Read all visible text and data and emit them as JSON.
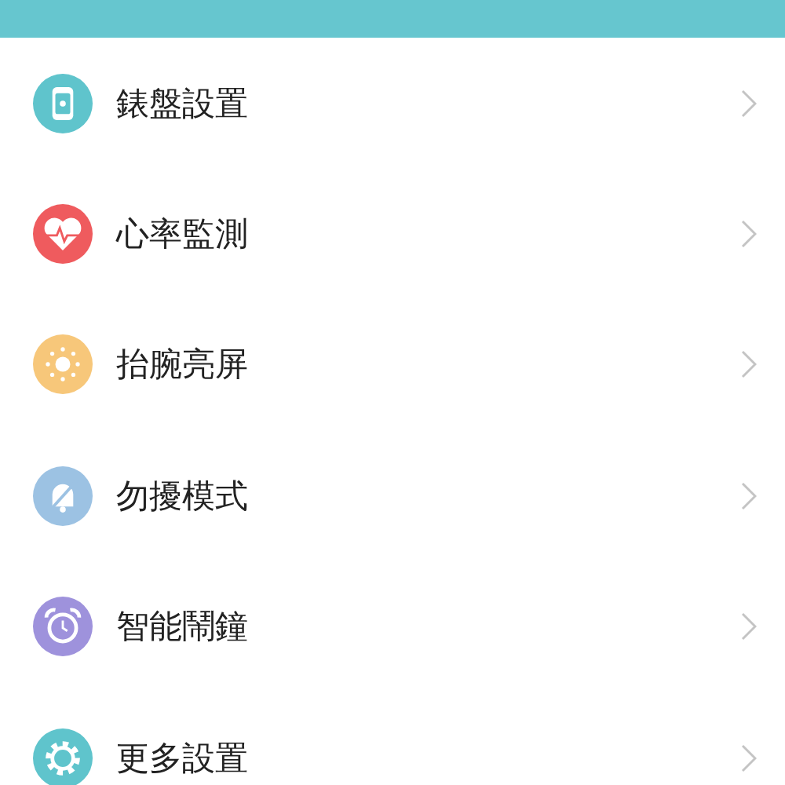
{
  "items": [
    {
      "kind": "watch",
      "color": "#5fc4cc",
      "label": "錶盤設置"
    },
    {
      "kind": "heart",
      "color": "#ef5b5e",
      "label": "心率監測"
    },
    {
      "kind": "sun",
      "color": "#f7c77a",
      "label": "抬腕亮屏"
    },
    {
      "kind": "bell-off",
      "color": "#9cc2e3",
      "label": "勿擾模式"
    },
    {
      "kind": "alarm",
      "color": "#9e92dc",
      "label": "智能鬧鐘"
    },
    {
      "kind": "gear",
      "color": "#5fc4cc",
      "label": "更多設置"
    }
  ]
}
